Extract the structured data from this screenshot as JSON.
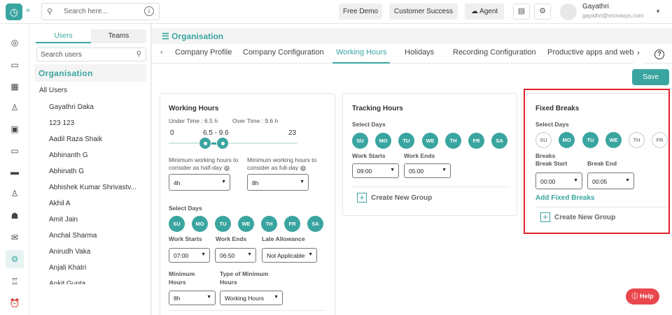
{
  "topbar": {
    "search_placeholder": "Search here...",
    "free_demo": "Free Demo",
    "customer_success": "Customer Success",
    "agent": "Agent",
    "user_name": "Gayathri",
    "user_email": "gayathri@snovasys.com"
  },
  "users_panel": {
    "tab_users": "Users",
    "tab_teams": "Teams",
    "search_placeholder": "Search users",
    "org": "Organisation",
    "all_users": "All Users",
    "users": [
      "Gayathri Daka",
      "123 123",
      "Aadil Raza Shaik",
      "Abhinanth G",
      "Abhinath G",
      "Abhishek Kumar Shrivastv...",
      "Akhil A",
      "Amit Jain",
      "Anchal Sharma",
      "Anirudh Vaka",
      "Anjali Khatri",
      "Ankit Gupta"
    ]
  },
  "main": {
    "title": "Organisation",
    "tabs": [
      "Company Profile",
      "Company Configuration",
      "Working Hours",
      "Holidays",
      "Recording Configuration",
      "Productive apps and web"
    ],
    "active_tab": "Working Hours",
    "save": "Save"
  },
  "working_hours": {
    "title": "Working Hours",
    "under_time": "Under Time : 6.5 h",
    "over_time": "Over Time : 9.6 h",
    "slider_min": "0",
    "slider_range": "6.5 - 9.6",
    "slider_max": "23",
    "slider_low": 6.5,
    "slider_high": 9.6,
    "min_half_day_label": "Minimum working hours to consider as half-day",
    "min_full_day_label": "Minimum working hours to consider as full-day",
    "half_day_value": "4h",
    "full_day_value": "8h",
    "select_days": "Select Days",
    "days": [
      "SU",
      "MO",
      "TU",
      "WE",
      "TH",
      "FR",
      "SA"
    ],
    "work_starts": "Work Starts",
    "work_ends": "Work Ends",
    "late_allowance": "Late Allowance",
    "start_value": "07:00",
    "end_value": "06:50",
    "late_value": "Not Applicable",
    "min_hours_label": "Minimum Hours",
    "type_min_hours_label": "Type of Minimum Hours",
    "min_hours_value": "8h",
    "type_value": "Working Hours"
  },
  "tracking_hours": {
    "title": "Tracking Hours",
    "select_days": "Select Days",
    "days": [
      "SU",
      "MO",
      "TU",
      "WE",
      "TH",
      "FR",
      "SA"
    ],
    "work_starts": "Work Starts",
    "work_ends": "Work Ends",
    "start_value": "09:00",
    "end_value": "05:00",
    "create_group": "Create New Group"
  },
  "fixed_breaks": {
    "title": "Fixed Breaks",
    "select_days": "Select Days",
    "days": [
      "SU",
      "MO",
      "TU",
      "WE",
      "TH",
      "FR"
    ],
    "breaks": "Breaks",
    "break_start": "Break Start",
    "break_end": "Break End",
    "start_value": "00:00",
    "end_value": "00:05",
    "add_fixed_breaks": "Add Fixed Breaks",
    "create_group": "Create New Group"
  },
  "help": "Help",
  "colors": {
    "accent": "#3aa5a0",
    "highlight": "#e0222a",
    "help": "#e9474d"
  }
}
